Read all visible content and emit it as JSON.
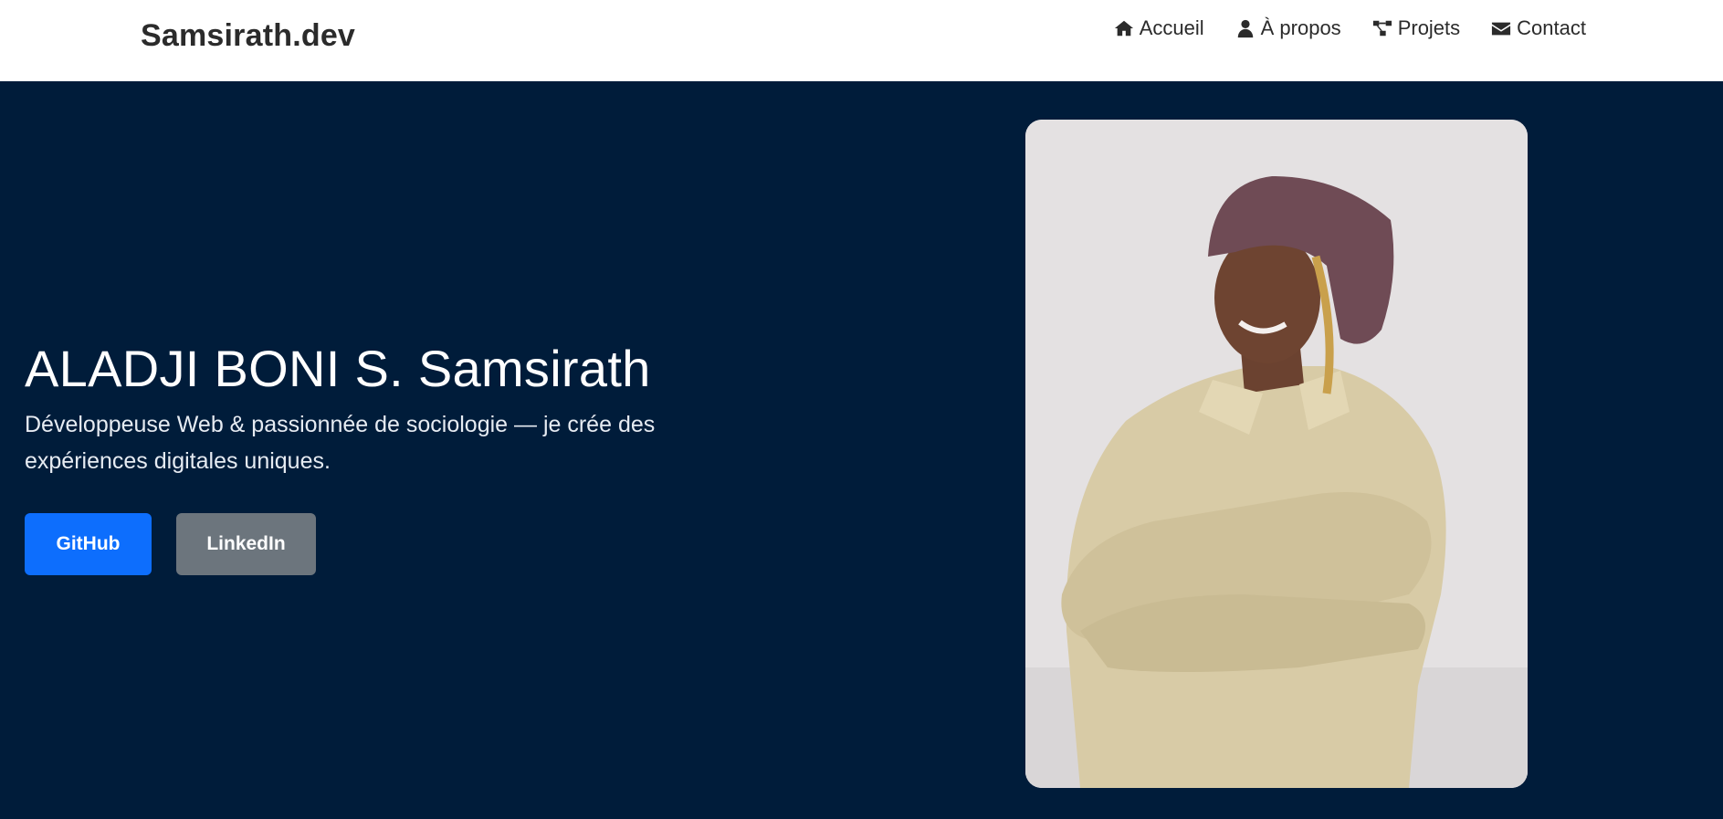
{
  "navbar": {
    "brand": "Samsirath.dev",
    "links": [
      {
        "label": "Accueil",
        "icon": "home-icon"
      },
      {
        "label": "À propos",
        "icon": "user-icon"
      },
      {
        "label": "Projets",
        "icon": "project-diagram-icon"
      },
      {
        "label": "Contact",
        "icon": "envelope-icon"
      }
    ]
  },
  "hero": {
    "title": "ALADJI BONI S. Samsirath",
    "subtitle": "Développeuse Web & passionnée de sociologie — je crée des expériences digitales uniques.",
    "buttons": {
      "github": "GitHub",
      "linkedin": "LinkedIn"
    },
    "photo_alt": "portrait-photo"
  },
  "colors": {
    "hero_bg": "#001c3a",
    "navbar_bg": "#ffffff",
    "primary_button": "#0d6efd",
    "secondary_button": "#6c757d"
  }
}
